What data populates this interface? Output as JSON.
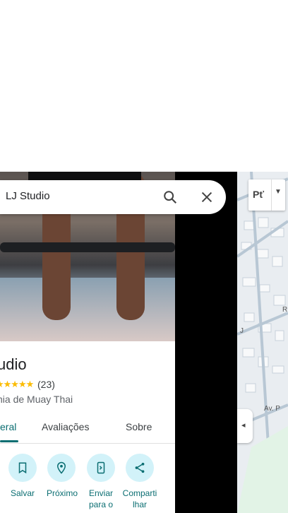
{
  "search": {
    "query": "LJ Studio"
  },
  "layer_button": {
    "label": "Pť"
  },
  "place": {
    "title": "udio",
    "stars": "★★★★★",
    "review_count": "(23)",
    "category": "nia de Muay Thai"
  },
  "tabs": [
    {
      "label": "eral"
    },
    {
      "label": "Avaliações"
    },
    {
      "label": "Sobre"
    }
  ],
  "actions": [
    {
      "label": "Salvar",
      "icon": "bookmark-icon"
    },
    {
      "label": "Próximo",
      "icon": "nearby-icon"
    },
    {
      "label": "Enviar para o",
      "icon": "send-to-phone-icon"
    },
    {
      "label": "Comparti lhar",
      "icon": "share-icon"
    }
  ],
  "map": {
    "streets": [
      "Av. P",
      "J",
      "R"
    ],
    "collapse_icon": "◂"
  },
  "colors": {
    "accent": "#0b6e72",
    "action_bg": "#d2f2f9",
    "star": "#fbbc04"
  }
}
